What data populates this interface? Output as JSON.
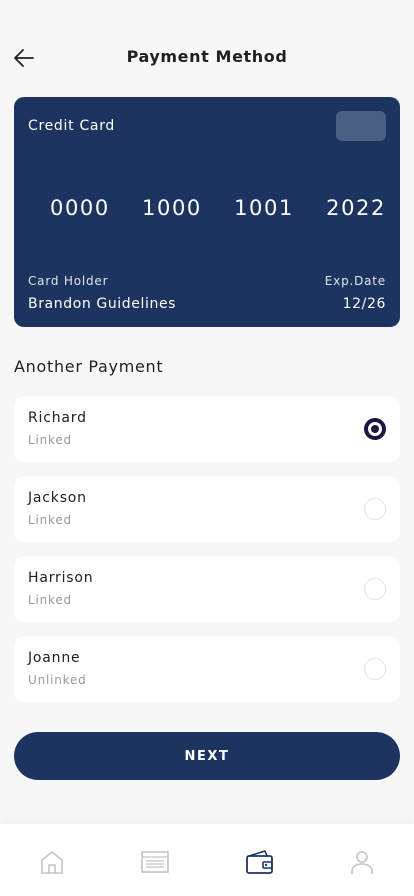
{
  "header": {
    "title": "Payment Method",
    "back_icon": "arrow-left-icon"
  },
  "card": {
    "type": "Credit Card",
    "number_groups": [
      "0000",
      "1000",
      "1001",
      "2022"
    ],
    "holder_label": "Card Holder",
    "holder_name": "Brandon Guidelines",
    "exp_label": "Exp.Date",
    "exp_value": "12/26",
    "color": "#1c345f"
  },
  "another_payment": {
    "title": "Another Payment",
    "items": [
      {
        "name": "Richard",
        "status": "Linked",
        "selected": true
      },
      {
        "name": "Jackson",
        "status": "Linked",
        "selected": false
      },
      {
        "name": "Harrison",
        "status": "Linked",
        "selected": false
      },
      {
        "name": "Joanne",
        "status": "Unlinked",
        "selected": false
      }
    ]
  },
  "next_button": {
    "label": "NEXT"
  },
  "bottom_nav": {
    "items": [
      {
        "icon": "home-icon",
        "active": false
      },
      {
        "icon": "list-icon",
        "active": false
      },
      {
        "icon": "wallet-icon",
        "active": true
      },
      {
        "icon": "profile-icon",
        "active": false
      }
    ],
    "active_color": "#1c345f",
    "inactive_color": "#c4c4c4"
  }
}
